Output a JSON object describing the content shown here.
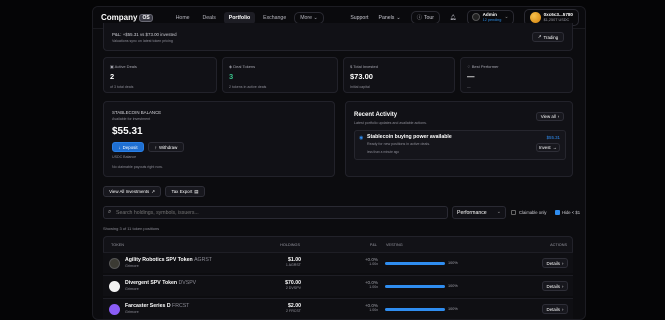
{
  "nav": {
    "logo": "Company",
    "logo_badge": "OS",
    "links": [
      "Home",
      "Deals",
      "Portfolio",
      "Exchange",
      "More"
    ],
    "support": "Support",
    "panels": "Panels",
    "tour": "Tour",
    "admin_name": "Admin",
    "admin_sub": "12 pending",
    "wallet_addr": "0xc6c3...5780",
    "wallet_bal": "$1,250T USDC"
  },
  "top_banner": {
    "line1": "P&L: +$55.31 vs $73.00 invested",
    "line2": "Valuations sync on latest token pricing",
    "trading": "Trading"
  },
  "stats": [
    {
      "label": "Active Deals",
      "value": "2",
      "sub": "of 3 total deals"
    },
    {
      "label": "Deal Tokens",
      "value": "3",
      "sub": "2 tokens in active deals"
    },
    {
      "label": "Total Invested",
      "value": "$73.00",
      "sub": "Initial capital"
    },
    {
      "label": "Best Performer",
      "value": "—",
      "sub": "—"
    }
  ],
  "stablecoin": {
    "title": "STABLECOIN BALANCE",
    "sub": "Available for investment",
    "value": "$55.31",
    "deposit": "Deposit",
    "withdraw": "Withdraw",
    "balance_label": "USDC Balance",
    "note": "No claimable payouts right now."
  },
  "activity": {
    "title": "Recent Activity",
    "sub": "Latest portfolio updates and available actions.",
    "view_all": "View all",
    "item_title": "Stablecoin buying power available",
    "item_sub": "Ready for new positions in active deals.",
    "item_time": "less than a minute ago",
    "item_amount": "$55.31",
    "item_action": "Invest"
  },
  "actions": {
    "view_all_investments": "View All Investments",
    "tax_export": "Tax Export"
  },
  "search": {
    "placeholder": "Search holdings, symbols, issuers...",
    "sort": "Performance",
    "claimable": "Claimable only",
    "hide": "Hide < $1"
  },
  "showing": "Showing 3 of 11 token positions",
  "table": {
    "headers": [
      "TOKEN",
      "HOLDINGS",
      "P&L",
      "VESTING",
      "ACTIONS"
    ],
    "rows": [
      {
        "name": "Agility Robotics SPV Token",
        "symbol": "AGRST",
        "issuer": "Grimore",
        "holding": "$1.00",
        "qty": "1 AGRST",
        "pnl": "+0.0%",
        "mult": "1.00x",
        "vesting": "100%",
        "vesting_pct": 1.0,
        "action": "Details",
        "icon_color": "#3b3a33"
      },
      {
        "name": "Divergent SPV Token",
        "symbol": "DVSPV",
        "issuer": "Grimore",
        "holding": "$70.00",
        "qty": "2 DVSPV",
        "pnl": "+0.0%",
        "mult": "1.00x",
        "vesting": "100%",
        "vesting_pct": 1.0,
        "action": "Details",
        "icon_color": "#f2f2f2"
      },
      {
        "name": "Farcaster Series D",
        "symbol": "FRCST",
        "issuer": "Grimore",
        "holding": "$2.00",
        "qty": "2 FRCST",
        "pnl": "+0.0%",
        "mult": "1.00x",
        "vesting": "100%",
        "vesting_pct": 1.0,
        "action": "Details",
        "icon_color": "#8a5cf6"
      }
    ]
  },
  "colors": {
    "accent": "#2f8df0",
    "positive": "#39c08a"
  }
}
